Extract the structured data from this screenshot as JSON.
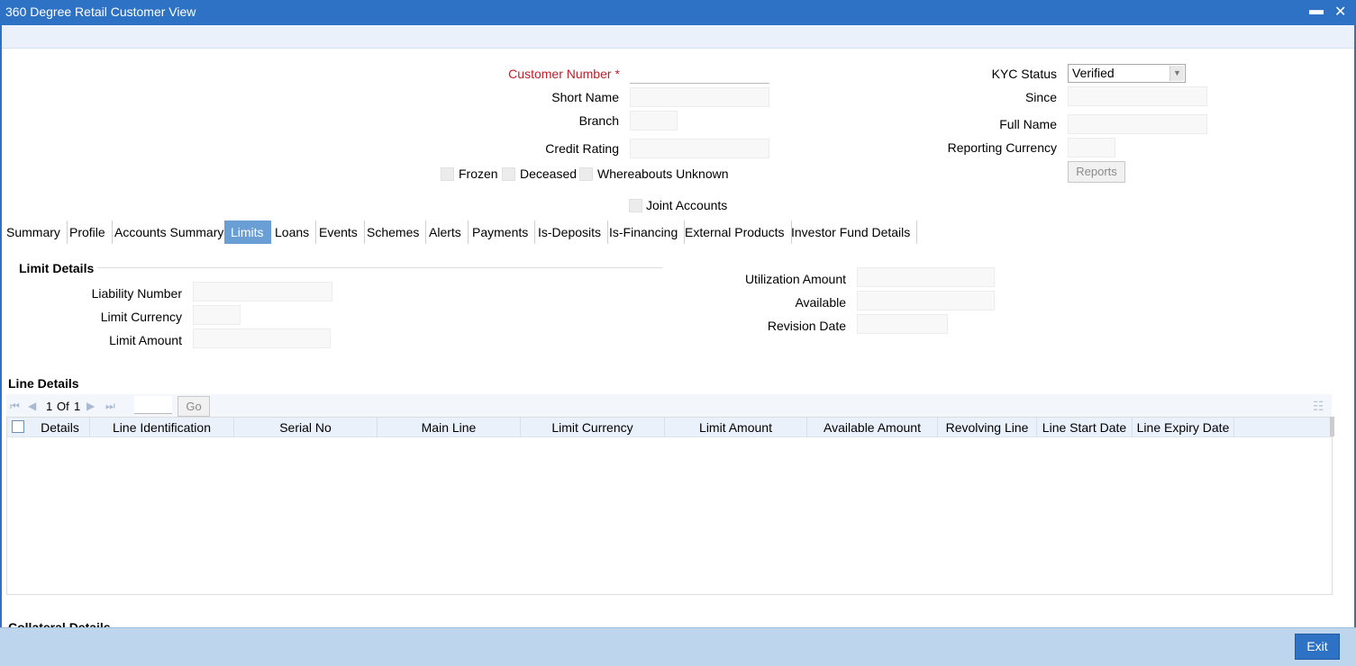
{
  "window": {
    "title": "360 Degree Retail Customer View",
    "minimize": "▬",
    "close": "✕"
  },
  "customer": {
    "customer_number_label": "Customer Number",
    "customer_number_value": "",
    "short_name_label": "Short Name",
    "branch_label": "Branch",
    "credit_rating_label": "Credit Rating",
    "frozen_label": "Frozen",
    "deceased_label": "Deceased",
    "whereabouts_label": "Whereabouts Unknown",
    "joint_accounts_label": "Joint Accounts",
    "kyc_status_label": "KYC Status",
    "kyc_status_value": "Verified",
    "since_label": "Since",
    "full_name_label": "Full Name",
    "reporting_currency_label": "Reporting Currency",
    "reports_button": "Reports"
  },
  "tabs": [
    {
      "label": "Summary"
    },
    {
      "label": "Profile"
    },
    {
      "label": "Accounts Summary"
    },
    {
      "label": "Limits",
      "active": true
    },
    {
      "label": "Loans"
    },
    {
      "label": "Events"
    },
    {
      "label": "Schemes"
    },
    {
      "label": "Alerts"
    },
    {
      "label": "Payments"
    },
    {
      "label": "Is-Deposits"
    },
    {
      "label": "Is-Financing"
    },
    {
      "label": "External Products"
    },
    {
      "label": "Investor Fund Details"
    }
  ],
  "limit_details": {
    "title": "Limit Details",
    "liability_number_label": "Liability Number",
    "limit_currency_label": "Limit Currency",
    "limit_amount_label": "Limit Amount",
    "utilization_amount_label": "Utilization Amount",
    "available_label": "Available",
    "revision_date_label": "Revision Date"
  },
  "line_details": {
    "title": "Line Details",
    "pagination": {
      "current": "1",
      "of_label": "Of",
      "total": "1",
      "go_button": "Go"
    },
    "columns": [
      "Details",
      "Line Identification",
      "Serial No",
      "Main Line",
      "Limit Currency",
      "Limit Amount",
      "Available Amount",
      "Revolving Line",
      "Line Start Date",
      "Line Expiry Date"
    ],
    "rows": []
  },
  "collateral_details": {
    "title": "Collateral Details"
  },
  "footer": {
    "exit_button": "Exit"
  }
}
